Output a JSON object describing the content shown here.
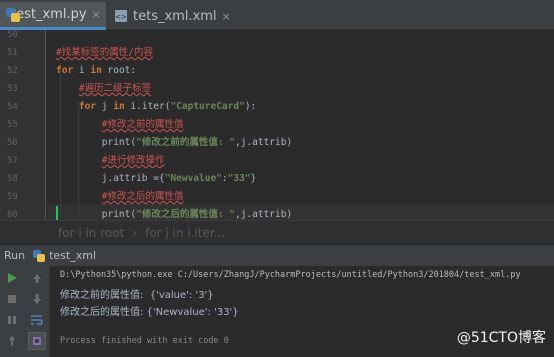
{
  "tabs": [
    {
      "label": "test_xml.py",
      "close": "×"
    },
    {
      "label": "tets_xml.xml",
      "close": "×"
    }
  ],
  "editor": {
    "line_numbers": [
      "50",
      "51",
      "52",
      "53",
      "54",
      "55",
      "56",
      "57",
      "58",
      "59",
      "60",
      "61"
    ],
    "lines": [
      [],
      [
        {
          "t": "#找某标签的属性/内容",
          "c": "cm"
        }
      ],
      [
        {
          "t": "for ",
          "c": "kw"
        },
        {
          "t": "i ",
          "c": "fn"
        },
        {
          "t": "in ",
          "c": "kw"
        },
        {
          "t": "root:",
          "c": "fn"
        }
      ],
      [
        {
          "t": "    "
        },
        {
          "t": "#遍历二级子标签",
          "c": "cm"
        }
      ],
      [
        {
          "t": "    "
        },
        {
          "t": "for ",
          "c": "kw"
        },
        {
          "t": "j ",
          "c": "fn"
        },
        {
          "t": "in ",
          "c": "kw"
        },
        {
          "t": "i.iter(",
          "c": "fn"
        },
        {
          "t": "\"CaptureCard\"",
          "c": "str"
        },
        {
          "t": "):",
          "c": "fn"
        }
      ],
      [
        {
          "t": "        "
        },
        {
          "t": "#修改之前的属性值",
          "c": "cm"
        }
      ],
      [
        {
          "t": "        "
        },
        {
          "t": "print(",
          "c": "fn"
        },
        {
          "t": "\"修改之前的属性值: \"",
          "c": "str"
        },
        {
          "t": ",j.attrib)",
          "c": "fn"
        }
      ],
      [
        {
          "t": "        "
        },
        {
          "t": "#进行修改操作",
          "c": "cm"
        }
      ],
      [
        {
          "t": "        "
        },
        {
          "t": "j.attrib ={",
          "c": "fn"
        },
        {
          "t": "\"Newvalue\"",
          "c": "str"
        },
        {
          "t": ":",
          "c": "fn"
        },
        {
          "t": "\"33\"",
          "c": "str"
        },
        {
          "t": "}",
          "c": "fn"
        }
      ],
      [
        {
          "t": "        "
        },
        {
          "t": "#修改之后的属性值",
          "c": "cm"
        }
      ],
      [
        {
          "t": "        "
        },
        {
          "t": "print(",
          "c": "fn"
        },
        {
          "t": "\"修改之后的属性值: \"",
          "c": "str"
        },
        {
          "t": ",j.attrib)",
          "c": "fn"
        }
      ],
      []
    ]
  },
  "breadcrumb": {
    "items": [
      "for i in root",
      "for j in i.iter..."
    ],
    "separator": "›"
  },
  "run": {
    "header_label": "Run",
    "config_name": "test_xml",
    "console": {
      "command": "D:\\Python35\\python.exe C:/Users/ZhangJ/PycharmProjects/untitled/Python3/201804/test_xml.py",
      "output": [
        "修改之前的属性值:  {'value': '3'}",
        "修改之后的属性值: {'Newvalue': '33'}"
      ],
      "finished": "Process finished with exit code 0"
    },
    "toolbar_icons": [
      "run-icon",
      "up-arrow-icon",
      "stop-icon",
      "down-arrow-icon",
      "pause-icon",
      "soft-wrap-icon",
      "pin-icon",
      "print-icon"
    ]
  },
  "watermark": "@51CTO博客",
  "colors": {
    "accent": "#4a88c7",
    "keyword": "#cc7832",
    "string": "#6a8759",
    "comment": "#d25252",
    "run_green": "#499c54"
  }
}
